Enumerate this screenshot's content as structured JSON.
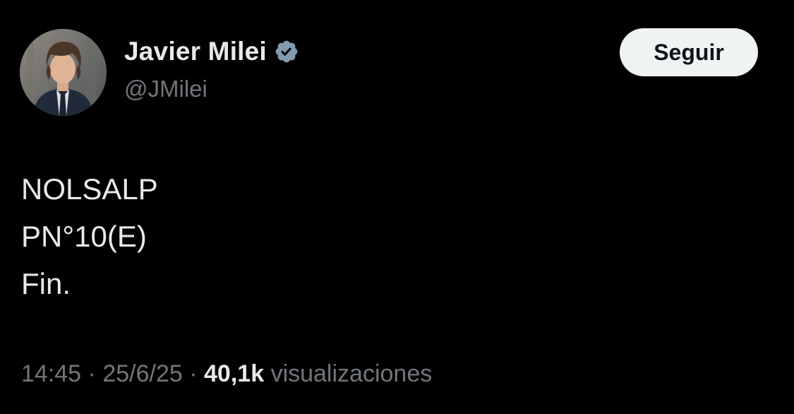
{
  "author": {
    "display_name": "Javier Milei",
    "handle": "@JMilei",
    "verified": true
  },
  "follow_button": {
    "label": "Seguir"
  },
  "tweet": {
    "lines": [
      "NOLSALP",
      "PN°10(E)",
      "Fin."
    ]
  },
  "meta": {
    "time": "14:45",
    "separator": "·",
    "date": "25/6/25",
    "views_count": "40,1k",
    "views_label": "visualizaciones"
  },
  "icons": {
    "verified": "verified-badge-icon"
  },
  "colors": {
    "background": "#000000",
    "primary_text": "#e7e9ea",
    "secondary_text": "#71767b",
    "button_bg": "#eff3f4",
    "verified_badge": "#829aab"
  }
}
